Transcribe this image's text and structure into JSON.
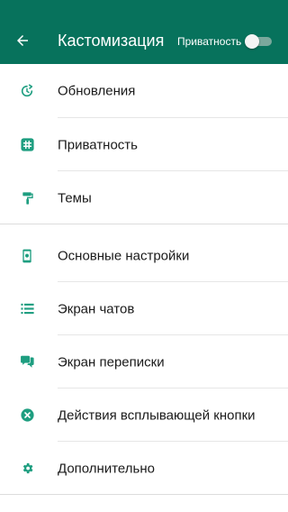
{
  "header": {
    "title": "Кастомизация",
    "privacy_label": "Приватность",
    "privacy_toggle_on": false
  },
  "colors": {
    "accent": "#07725c",
    "icon": "#1e9e80"
  },
  "section1": [
    {
      "label": "Обновления",
      "icon": "update-icon"
    },
    {
      "label": "Приватность",
      "icon": "privacy-hash-icon"
    },
    {
      "label": "Темы",
      "icon": "paint-roller-icon"
    }
  ],
  "section2": [
    {
      "label": "Основные настройки",
      "icon": "phone-settings-icon"
    },
    {
      "label": "Экран чатов",
      "icon": "list-icon"
    },
    {
      "label": "Экран переписки",
      "icon": "chat-bubbles-icon"
    },
    {
      "label": "Действия всплывающей кнопки",
      "icon": "close-circle-icon"
    },
    {
      "label": "Дополнительно",
      "icon": "gear-icon"
    }
  ]
}
